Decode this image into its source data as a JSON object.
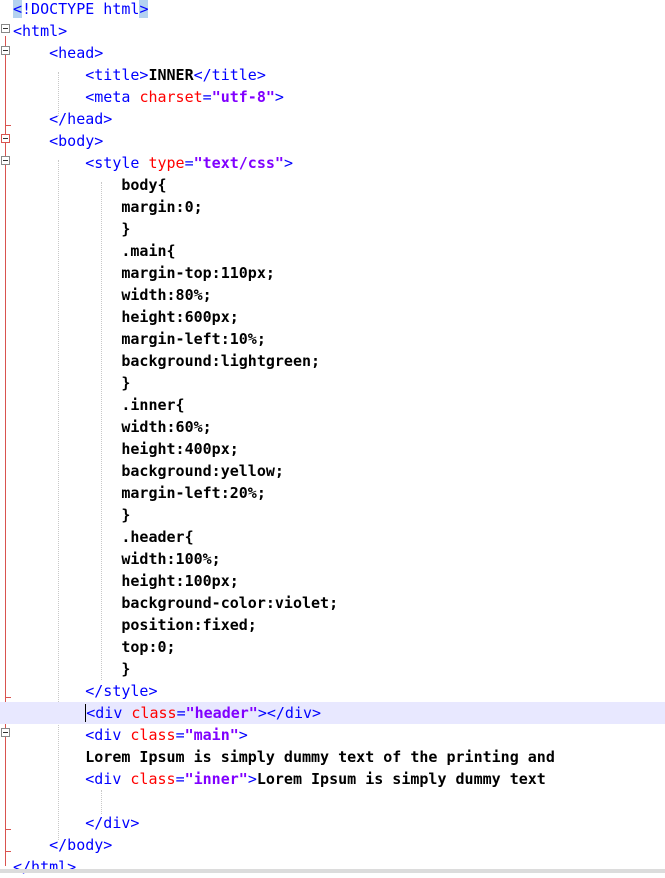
{
  "lines": [
    {
      "parts": [
        {
          "c": "hl",
          "t": "<"
        },
        {
          "c": "tag",
          "t": "!DOCTYPE html"
        },
        {
          "c": "hl",
          "t": ">"
        }
      ]
    },
    {
      "parts": [
        {
          "c": "tag",
          "t": "<html>"
        }
      ]
    },
    {
      "parts": [
        {
          "c": "sp",
          "t": "    "
        },
        {
          "c": "tag",
          "t": "<head>"
        }
      ]
    },
    {
      "parts": [
        {
          "c": "sp",
          "t": "        "
        },
        {
          "c": "tag",
          "t": "<title>"
        },
        {
          "c": "txt",
          "t": "INNER"
        },
        {
          "c": "tag",
          "t": "</title>"
        }
      ]
    },
    {
      "parts": [
        {
          "c": "sp",
          "t": "        "
        },
        {
          "c": "tag",
          "t": "<meta "
        },
        {
          "c": "attr",
          "t": "charset"
        },
        {
          "c": "tag",
          "t": "="
        },
        {
          "c": "val",
          "t": "\"utf-8\""
        },
        {
          "c": "tag",
          "t": ">"
        }
      ]
    },
    {
      "parts": [
        {
          "c": "sp",
          "t": "    "
        },
        {
          "c": "tag",
          "t": "</head>"
        }
      ]
    },
    {
      "parts": [
        {
          "c": "sp",
          "t": "    "
        },
        {
          "c": "tag",
          "t": "<body>"
        }
      ]
    },
    {
      "parts": [
        {
          "c": "sp",
          "t": "        "
        },
        {
          "c": "tag",
          "t": "<style "
        },
        {
          "c": "attr",
          "t": "type"
        },
        {
          "c": "tag",
          "t": "="
        },
        {
          "c": "val",
          "t": "\"text/css\""
        },
        {
          "c": "tag",
          "t": ">"
        }
      ]
    },
    {
      "parts": [
        {
          "c": "sp",
          "t": "            "
        },
        {
          "c": "css",
          "t": "body{"
        }
      ]
    },
    {
      "parts": [
        {
          "c": "sp",
          "t": "            "
        },
        {
          "c": "css",
          "t": "margin:0;"
        }
      ]
    },
    {
      "parts": [
        {
          "c": "sp",
          "t": "            "
        },
        {
          "c": "css",
          "t": "}"
        }
      ]
    },
    {
      "parts": [
        {
          "c": "sp",
          "t": "            "
        },
        {
          "c": "css",
          "t": ".main{"
        }
      ]
    },
    {
      "parts": [
        {
          "c": "sp",
          "t": "            "
        },
        {
          "c": "css",
          "t": "margin-top:110px;"
        }
      ]
    },
    {
      "parts": [
        {
          "c": "sp",
          "t": "            "
        },
        {
          "c": "css",
          "t": "width:80%;"
        }
      ]
    },
    {
      "parts": [
        {
          "c": "sp",
          "t": "            "
        },
        {
          "c": "css",
          "t": "height:600px;"
        }
      ]
    },
    {
      "parts": [
        {
          "c": "sp",
          "t": "            "
        },
        {
          "c": "css",
          "t": "margin-left:10%;"
        }
      ]
    },
    {
      "parts": [
        {
          "c": "sp",
          "t": "            "
        },
        {
          "c": "css",
          "t": "background:lightgreen;"
        }
      ]
    },
    {
      "parts": [
        {
          "c": "sp",
          "t": "            "
        },
        {
          "c": "css",
          "t": "}"
        }
      ]
    },
    {
      "parts": [
        {
          "c": "sp",
          "t": "            "
        },
        {
          "c": "css",
          "t": ".inner{"
        }
      ]
    },
    {
      "parts": [
        {
          "c": "sp",
          "t": "            "
        },
        {
          "c": "css",
          "t": "width:60%;"
        }
      ]
    },
    {
      "parts": [
        {
          "c": "sp",
          "t": "            "
        },
        {
          "c": "css",
          "t": "height:400px;"
        }
      ]
    },
    {
      "parts": [
        {
          "c": "sp",
          "t": "            "
        },
        {
          "c": "css",
          "t": "background:yellow;"
        }
      ]
    },
    {
      "parts": [
        {
          "c": "sp",
          "t": "            "
        },
        {
          "c": "css",
          "t": "margin-left:20%;"
        }
      ]
    },
    {
      "parts": [
        {
          "c": "sp",
          "t": "            "
        },
        {
          "c": "css",
          "t": "}"
        }
      ]
    },
    {
      "parts": [
        {
          "c": "sp",
          "t": "            "
        },
        {
          "c": "css",
          "t": ".header{"
        }
      ]
    },
    {
      "parts": [
        {
          "c": "sp",
          "t": "            "
        },
        {
          "c": "css",
          "t": "width:100%;"
        }
      ]
    },
    {
      "parts": [
        {
          "c": "sp",
          "t": "            "
        },
        {
          "c": "css",
          "t": "height:100px;"
        }
      ]
    },
    {
      "parts": [
        {
          "c": "sp",
          "t": "            "
        },
        {
          "c": "css",
          "t": "background-color:violet;"
        }
      ]
    },
    {
      "parts": [
        {
          "c": "sp",
          "t": "            "
        },
        {
          "c": "css",
          "t": "position:fixed;"
        }
      ]
    },
    {
      "parts": [
        {
          "c": "sp",
          "t": "            "
        },
        {
          "c": "css",
          "t": "top:0;"
        }
      ]
    },
    {
      "parts": [
        {
          "c": "sp",
          "t": "            "
        },
        {
          "c": "css",
          "t": "}"
        }
      ]
    },
    {
      "parts": [
        {
          "c": "sp",
          "t": "        "
        },
        {
          "c": "tag",
          "t": "</style>"
        }
      ]
    },
    {
      "current": true,
      "parts": [
        {
          "c": "sp",
          "t": "        "
        },
        {
          "c": "tag caret",
          "t": "<div "
        },
        {
          "c": "attr",
          "t": "class"
        },
        {
          "c": "tag",
          "t": "="
        },
        {
          "c": "val",
          "t": "\"header\""
        },
        {
          "c": "tag",
          "t": "></div>"
        }
      ]
    },
    {
      "parts": [
        {
          "c": "sp",
          "t": "        "
        },
        {
          "c": "tag",
          "t": "<div "
        },
        {
          "c": "attr",
          "t": "class"
        },
        {
          "c": "tag",
          "t": "="
        },
        {
          "c": "val",
          "t": "\"main\""
        },
        {
          "c": "tag",
          "t": ">"
        }
      ]
    },
    {
      "parts": [
        {
          "c": "sp",
          "t": "        "
        },
        {
          "c": "txt",
          "t": "Lorem Ipsum is simply dummy text of the printing and"
        }
      ]
    },
    {
      "parts": [
        {
          "c": "sp",
          "t": "        "
        },
        {
          "c": "tag",
          "t": "<div "
        },
        {
          "c": "attr",
          "t": "class"
        },
        {
          "c": "tag",
          "t": "="
        },
        {
          "c": "val",
          "t": "\"inner\""
        },
        {
          "c": "tag",
          "t": ">"
        },
        {
          "c": "txt",
          "t": "Lorem Ipsum is simply dummy text"
        }
      ]
    },
    {
      "parts": []
    },
    {
      "parts": [
        {
          "c": "sp",
          "t": "        "
        },
        {
          "c": "tag",
          "t": "</div>"
        }
      ]
    },
    {
      "parts": [
        {
          "c": "sp",
          "t": "    "
        },
        {
          "c": "tag",
          "t": "</body>"
        }
      ]
    },
    {
      "parts": [
        {
          "c": "tag",
          "t": "</html>"
        }
      ]
    }
  ]
}
